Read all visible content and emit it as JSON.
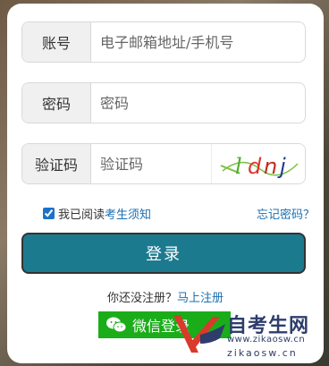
{
  "form": {
    "account": {
      "label": "账号",
      "placeholder": "电子邮箱地址/手机号"
    },
    "password": {
      "label": "密码",
      "placeholder": "密码"
    },
    "captcha": {
      "label": "验证码",
      "placeholder": "验证码",
      "image_text": "ldnj"
    },
    "agree": {
      "prefix": "我已阅读",
      "link": "考生须知",
      "checked": true
    },
    "forgot_link": "忘记密码？",
    "login_button": "登录",
    "register_prompt": "你还没注册？",
    "register_link": "马上注册",
    "wechat_button": "微信登录"
  },
  "watermark": {
    "brand": "自考生网",
    "url": "www.zikaosw.cn",
    "url_alt": "zikaosw.cn"
  },
  "colors": {
    "login_button": "#1c7a8f",
    "wechat": "#1aad19",
    "link": "#1a6fb0"
  }
}
